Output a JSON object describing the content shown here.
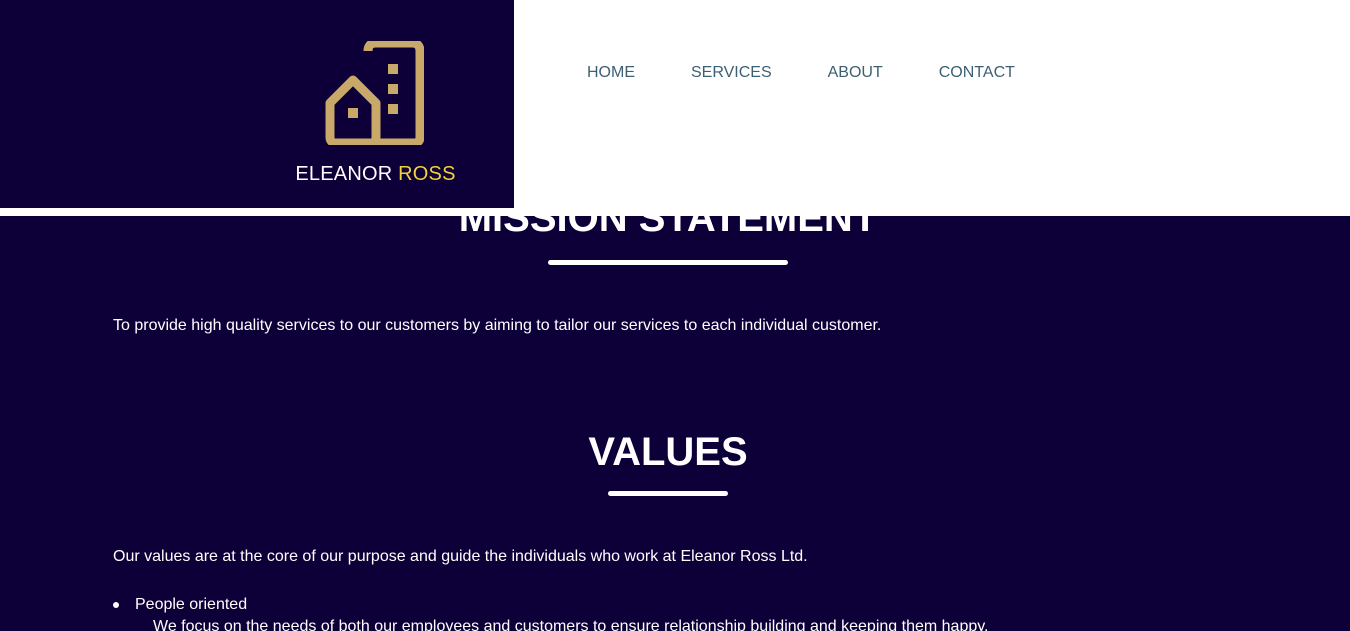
{
  "brand": {
    "name_part1": "ELEANOR",
    "name_part2": "ROSS",
    "logo_icon": "building-icon",
    "accent_color": "#f2d23a",
    "logo_color": "#c8a96a"
  },
  "nav": {
    "items": [
      {
        "label": "HOME"
      },
      {
        "label": "SERVICES"
      },
      {
        "label": "ABOUT"
      },
      {
        "label": "CONTACT"
      }
    ]
  },
  "mission": {
    "title": "MISSION STATEMENT",
    "text": "To provide high quality services to our customers by aiming to tailor our services to each individual customer."
  },
  "values": {
    "title": "VALUES",
    "intro": "Our values are at the core of our purpose and guide the individuals who work at Eleanor Ross Ltd.",
    "items": [
      {
        "label": "People oriented",
        "description": "We focus on the needs of both our employees and customers to ensure relationship building and keeping them happy."
      }
    ]
  },
  "colors": {
    "background": "#0d0038",
    "header_bg": "#ffffff",
    "nav_text": "#3d5f73"
  }
}
